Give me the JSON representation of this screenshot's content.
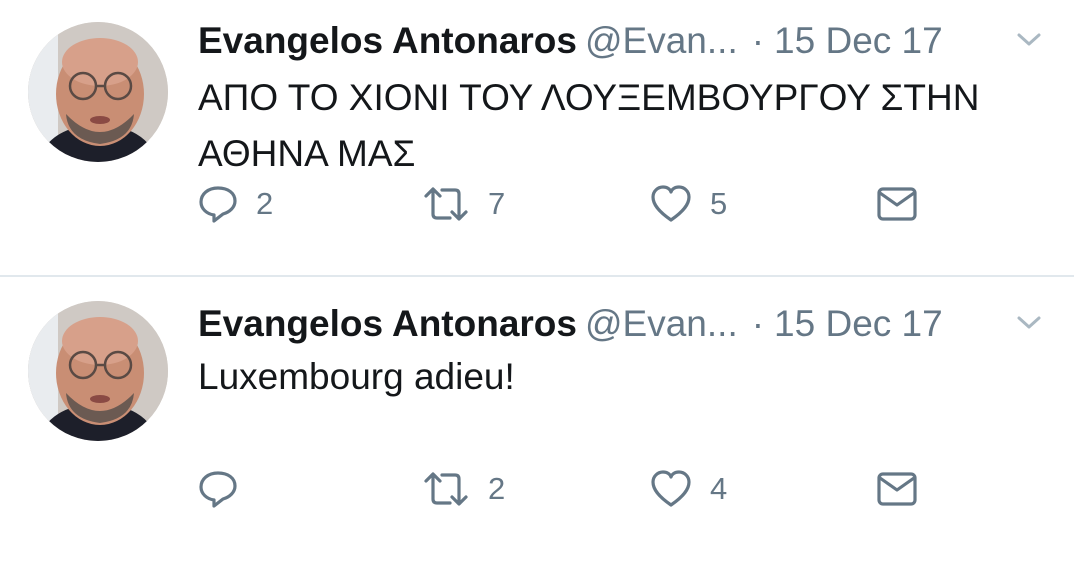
{
  "tweets": [
    {
      "author_name": "Evangelos Antonaros",
      "handle": "@Evan...",
      "separator": "·",
      "date": "15 Dec 17",
      "text_lines": [
        "ΑΠΟ ΤΟ ΧΙΟΝΙ ΤΟΥ ΛΟΥΞΕΜΒΟΥΡΓΟΥ ΣΤΗΝ",
        "ΑΘΗΝΑ ΜΑΣ"
      ],
      "reply_count": "2",
      "retweet_count": "7",
      "like_count": "5"
    },
    {
      "author_name": "Evangelos Antonaros",
      "handle": "@Evan...",
      "separator": "·",
      "date": "15 Dec 17",
      "text_lines": [
        "Luxembourg adieu!"
      ],
      "reply_count": "",
      "retweet_count": "2",
      "like_count": "4"
    }
  ],
  "icons": {
    "reply": "reply-icon",
    "retweet": "retweet-icon",
    "like": "heart-icon",
    "dm": "mail-icon",
    "more": "chevron-down-icon"
  },
  "colors": {
    "text": "#14171a",
    "secondary": "#657786",
    "divider": "#e1e8ed"
  }
}
